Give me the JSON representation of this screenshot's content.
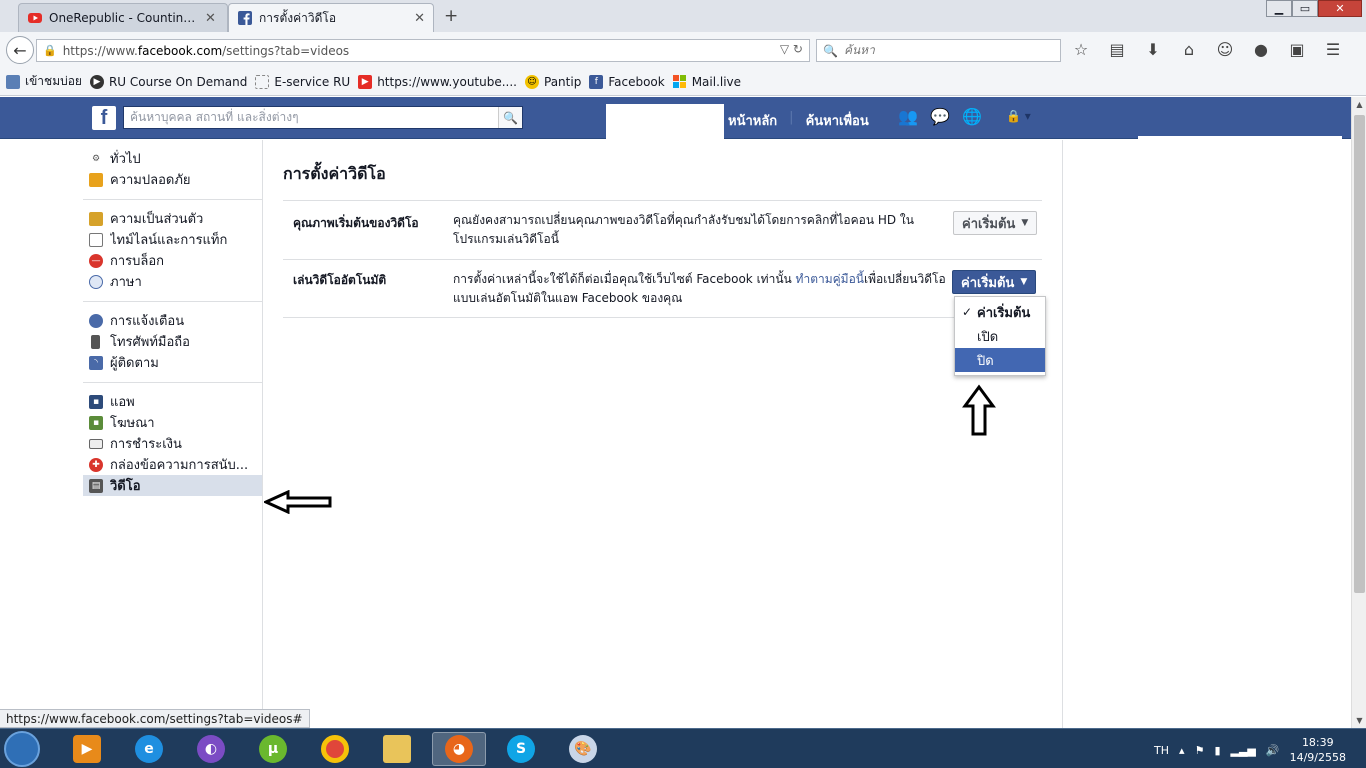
{
  "browser": {
    "tabs": [
      {
        "label": "OneRepublic - Counting St...",
        "close": "✕"
      },
      {
        "label": "การตั้งค่าวิดีโอ",
        "close": "✕"
      }
    ],
    "new_tab": "+",
    "url": {
      "prefix": "https://www.",
      "host": "facebook.com",
      "suffix": "/settings?tab=videos"
    },
    "search_placeholder": "ค้นหา",
    "bookmarks": [
      "เข้าชมบ่อย",
      "RU Course On Demand",
      "E-service RU",
      "https://www.youtube....",
      "Pantip",
      "Facebook",
      "Mail.live"
    ]
  },
  "facebook": {
    "search_placeholder": "ค้นหาบุคคล สถานที่ และสิ่งต่างๆ",
    "nav": {
      "home": "หน้าหลัก",
      "find_friends": "ค้นหาเพื่อน"
    }
  },
  "sidebar": {
    "groups": [
      [
        {
          "label": "ทั่วไป",
          "icon": "gear-icon"
        },
        {
          "label": "ความปลอดภัย",
          "icon": "shield-icon"
        }
      ],
      [
        {
          "label": "ความเป็นส่วนตัว",
          "icon": "lock-icon"
        },
        {
          "label": "ไทม์ไลน์และการแท็ก",
          "icon": "timeline-icon"
        },
        {
          "label": "การบล็อก",
          "icon": "block-icon"
        },
        {
          "label": "ภาษา",
          "icon": "globe-icon"
        }
      ],
      [
        {
          "label": "การแจ้งเตือน",
          "icon": "globe-notification-icon"
        },
        {
          "label": "โทรศัพท์มือถือ",
          "icon": "mobile-icon"
        },
        {
          "label": "ผู้ติดตาม",
          "icon": "rss-icon"
        }
      ],
      [
        {
          "label": "แอพ",
          "icon": "apps-icon"
        },
        {
          "label": "โฆษณา",
          "icon": "ads-icon"
        },
        {
          "label": "การชำระเงิน",
          "icon": "card-icon"
        },
        {
          "label": "กล่องข้อความการสนับ...",
          "icon": "support-icon"
        },
        {
          "label": "วิดีโอ",
          "icon": "film-icon",
          "active": true
        }
      ]
    ]
  },
  "main": {
    "title": "การตั้งค่าวิดีโอ",
    "rows": [
      {
        "label": "คุณภาพเริ่มต้นของวิดีโอ",
        "desc": "คุณยังคงสามารถเปลี่ยนคุณภาพของวิดีโอที่คุณกำลังรับชมได้โดยการคลิกที่ไอคอน HD ในโปรแกรมเล่นวิดีโอนี้",
        "value": "ค่าเริ่มต้น"
      },
      {
        "label": "เล่นวิดีโออัตโนมัติ",
        "desc_before": "การตั้งค่าเหล่านี้จะใช้ได้ก็ต่อเมื่อคุณใช้เว็บไซต์ Facebook เท่านั้น ",
        "desc_link": "ทำตามคู่มือนี้",
        "desc_after": "เพื่อเปลี่ยนวิดีโอแบบเล่นอัตโนมัติในแอพ Facebook ของคุณ",
        "value": "ค่าเริ่มต้น",
        "options": [
          "ค่าเริ่มต้น",
          "เปิด",
          "ปิด"
        ]
      }
    ]
  },
  "status_bar": "https://www.facebook.com/settings?tab=videos#",
  "taskbar": {
    "lang": "TH",
    "time": "18:39",
    "date": "14/9/2558"
  },
  "colors": {
    "fb_blue": "#3b5998",
    "link": "#3b5998"
  }
}
